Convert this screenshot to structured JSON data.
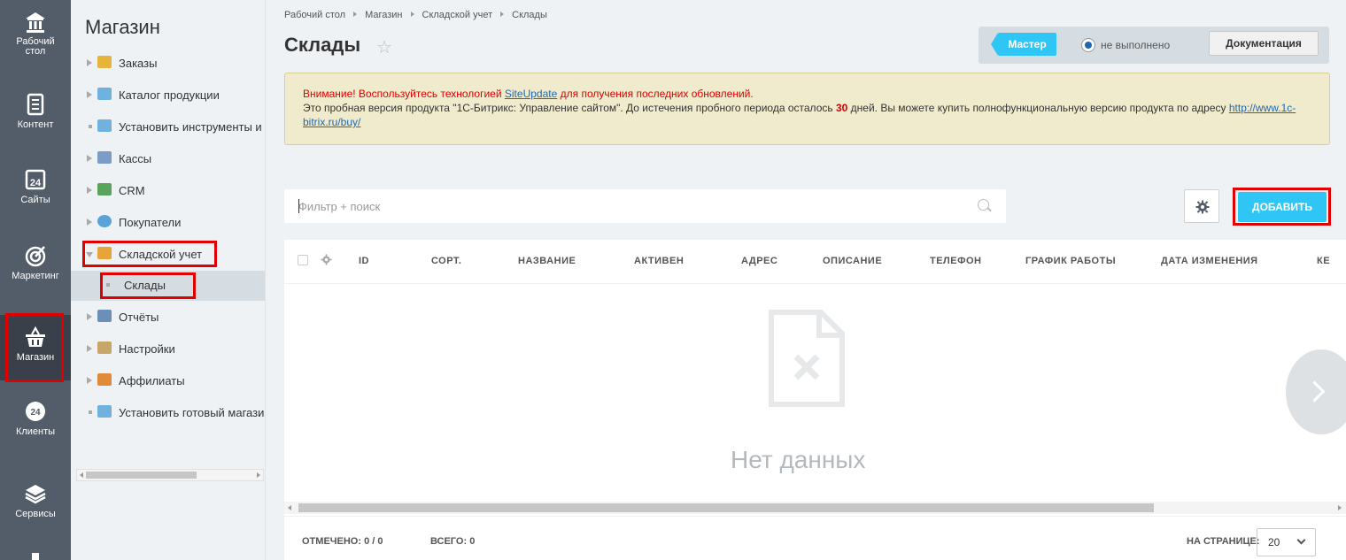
{
  "rail": {
    "items": [
      {
        "label": "Рабочий стол",
        "icon": "home-icon"
      },
      {
        "label": "Контент",
        "icon": "document-icon"
      },
      {
        "label": "Сайты",
        "icon": "calendar-24-icon"
      },
      {
        "label": "Маркетинг",
        "icon": "target-icon"
      },
      {
        "label": "Магазин",
        "icon": "basket-icon",
        "active": true
      },
      {
        "label": "Клиенты",
        "icon": "clients-24-icon"
      },
      {
        "label": "Сервисы",
        "icon": "layers-icon"
      }
    ]
  },
  "menu": {
    "title": "Магазин",
    "items": [
      {
        "label": "Заказы",
        "icon": "orders-icon",
        "color": "#e6b43c"
      },
      {
        "label": "Каталог продукции",
        "icon": "folder-icon",
        "color": "#6fb2e0"
      },
      {
        "label": "Установить инструменты и",
        "icon": "folder-icon",
        "color": "#6fb2e0"
      },
      {
        "label": "Кассы",
        "icon": "cash-register-icon",
        "color": "#7a9cc6"
      },
      {
        "label": "CRM",
        "icon": "crm-funnel-icon",
        "color": "#5aa35a"
      },
      {
        "label": "Покупатели",
        "icon": "buyers-icon",
        "color": "#5aa3d8"
      },
      {
        "label": "Складской учет",
        "icon": "warehouse-icon",
        "color": "#e8a33a"
      },
      {
        "label": "Склады",
        "icon": "bullet-icon"
      },
      {
        "label": "Отчёты",
        "icon": "reports-icon",
        "color": "#6b8fb8"
      },
      {
        "label": "Настройки",
        "icon": "settings-icon",
        "color": "#c8a66a"
      },
      {
        "label": "Аффилиаты",
        "icon": "affiliates-icon",
        "color": "#e08a3a"
      },
      {
        "label": "Установить готовый магазин",
        "icon": "cart-icon",
        "color": "#6fb2e0"
      }
    ]
  },
  "breadcrumb": [
    "Рабочий стол",
    "Магазин",
    "Складской учет",
    "Склады"
  ],
  "page": {
    "title": "Склады"
  },
  "master": {
    "button": "Мастер",
    "status": "не выполнено",
    "doc_button": "Документация"
  },
  "notice": {
    "warn_prefix": "Внимание! Воспользуйтесь технологией",
    "link1": "SiteUpdate",
    "warn_suffix": "для получения последних обновлений.",
    "text1": "Это пробная версия продукта \"1С-Битрикс: Управление сайтом\". До истечения пробного периода осталось",
    "days": "30",
    "text2": "дней. Вы можете купить полнофункциональную версию продукта по адресу",
    "link2": "http://www.1c-bitrix.ru/buy/"
  },
  "filter": {
    "placeholder": "Фильтр + поиск"
  },
  "add_button": "ДОБАВИТЬ",
  "grid": {
    "columns": [
      "ID",
      "СОРТ.",
      "НАЗВАНИЕ",
      "АКТИВЕН",
      "АДРЕС",
      "ОПИСАНИЕ",
      "ТЕЛЕФОН",
      "ГРАФИК РАБОТЫ",
      "ДАТА ИЗМЕНЕНИЯ",
      "КЕ"
    ],
    "empty_text": "Нет данных"
  },
  "footer": {
    "checked_label": "ОТМЕЧЕНО:",
    "checked_value": "0 / 0",
    "total_label": "ВСЕГО:",
    "total_value": "0",
    "per_page_label": "НА СТРАНИЦЕ:",
    "per_page_value": "20"
  },
  "colors": {
    "accent": "#2fc6f6",
    "rail": "#535c69",
    "highlight": "#e00000"
  }
}
